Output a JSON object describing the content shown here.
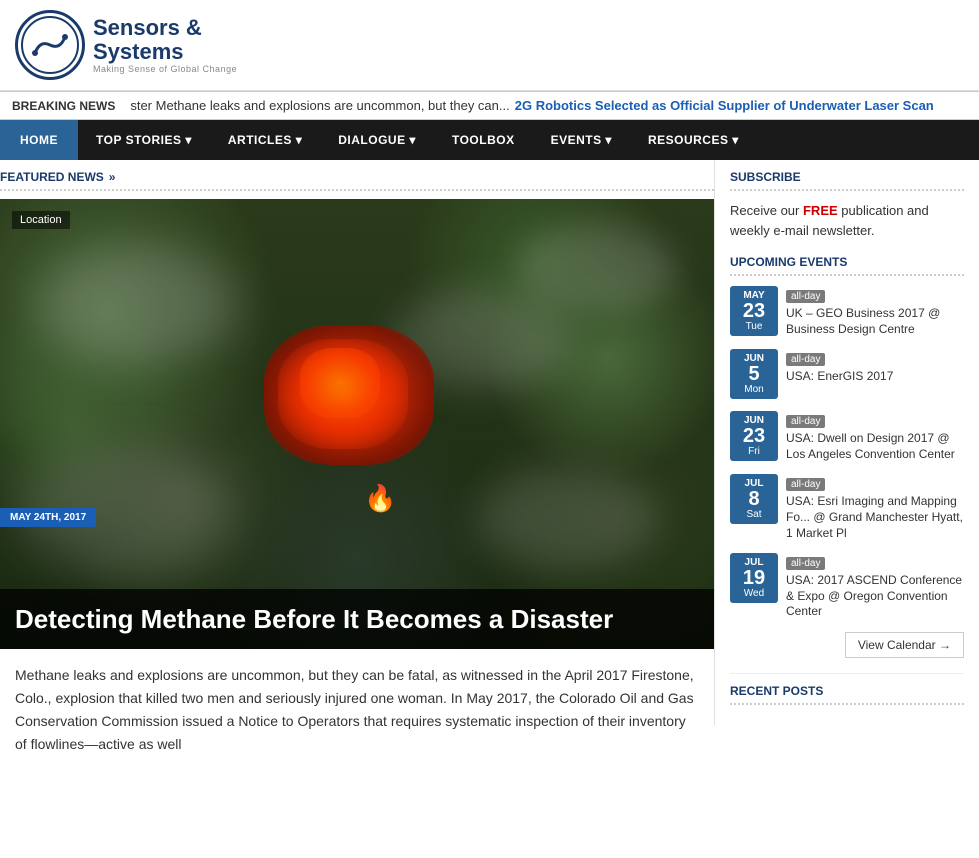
{
  "header": {
    "logo_line1": "Sensors &",
    "logo_line2": "Systems",
    "tagline": "Making Sense of Global Change"
  },
  "breaking_news": {
    "label": "BREAKING NEWS",
    "text1": "ster  Methane leaks and explosions are uncommon, but they can...",
    "text2": "2G Robotics Selected as Official Supplier of Underwater Laser Scan"
  },
  "nav": {
    "items": [
      {
        "label": "HOME",
        "active": true
      },
      {
        "label": "TOP STORIES ▾",
        "active": false
      },
      {
        "label": "ARTICLES ▾",
        "active": false
      },
      {
        "label": "DIALOGUE ▾",
        "active": false
      },
      {
        "label": "TOOLBOX",
        "active": false
      },
      {
        "label": "EVENTS ▾",
        "active": false
      },
      {
        "label": "RESOURCES ▾",
        "active": false
      }
    ]
  },
  "featured": {
    "section_label": "FEATURED NEWS",
    "date": "MAY 24TH, 2017",
    "title": "Detecting Methane Before It Becomes a Disaster",
    "location": "Location",
    "body": "Methane leaks and explosions are uncommon, but they can be fatal, as witnessed in the April 2017 Firestone, Colo., explosion that killed two men and seriously injured one woman. In May 2017, the Colorado Oil and Gas Conservation Commission issued a Notice to Operators that requires systematic inspection of their inventory of flowlines—active as well"
  },
  "sidebar": {
    "subscribe": {
      "title": "SUBSCRIBE",
      "text": "Receive our FREE publication and weekly e-mail newsletter.",
      "free_word": "FREE"
    },
    "upcoming_events": {
      "title": "UPCOMING EVENTS",
      "events": [
        {
          "month": "MAY",
          "day": "23",
          "weekday": "Tue",
          "badge": "all-day",
          "name": "UK – GEO Business 2017 @ Business Design Centre"
        },
        {
          "month": "JUN",
          "day": "5",
          "weekday": "Mon",
          "badge": "all-day",
          "name": "USA: EnerGIS 2017"
        },
        {
          "month": "JUN",
          "day": "23",
          "weekday": "Fri",
          "badge": "all-day",
          "name": "USA: Dwell on Design 2017 @ Los Angeles Convention Center"
        },
        {
          "month": "JUL",
          "day": "8",
          "weekday": "Sat",
          "badge": "all-day",
          "name": "USA: Esri Imaging and Mapping Fo... @ Grand Manchester Hyatt, 1 Market Pl"
        },
        {
          "month": "JUL",
          "day": "19",
          "weekday": "Wed",
          "badge": "all-day",
          "name": "USA: 2017 ASCEND Conference & Expo @ Oregon Convention Center"
        }
      ],
      "view_calendar": "View Calendar →"
    },
    "recent_posts": {
      "title": "RECENT POSTS"
    }
  }
}
